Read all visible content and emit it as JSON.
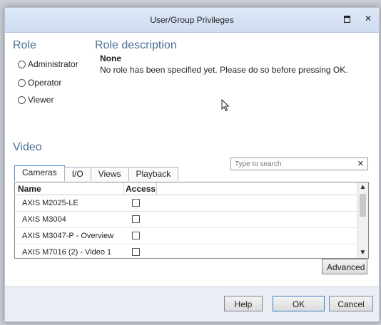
{
  "window": {
    "title": "User/Group Privileges"
  },
  "role": {
    "heading": "Role",
    "options": [
      {
        "label": "Administrator"
      },
      {
        "label": "Operator"
      },
      {
        "label": "Viewer"
      }
    ]
  },
  "role_description": {
    "heading": "Role description",
    "name": "None",
    "text": "No role has been specified yet. Please do so before pressing OK."
  },
  "video": {
    "heading": "Video",
    "search_placeholder": "Type to search",
    "tabs": [
      {
        "label": "Cameras"
      },
      {
        "label": "I/O"
      },
      {
        "label": "Views"
      },
      {
        "label": "Playback"
      }
    ],
    "columns": {
      "name": "Name",
      "access": "Access"
    },
    "rows": [
      {
        "name": "AXIS M2025-LE",
        "access": false
      },
      {
        "name": "AXIS M3004",
        "access": false
      },
      {
        "name": "AXIS M3047-P - Overview",
        "access": false
      },
      {
        "name": "AXIS M7016 (2) - Video 1",
        "access": false
      }
    ],
    "advanced_label": "Advanced"
  },
  "footer": {
    "help_label": "Help",
    "ok_label": "OK",
    "cancel_label": "Cancel"
  }
}
